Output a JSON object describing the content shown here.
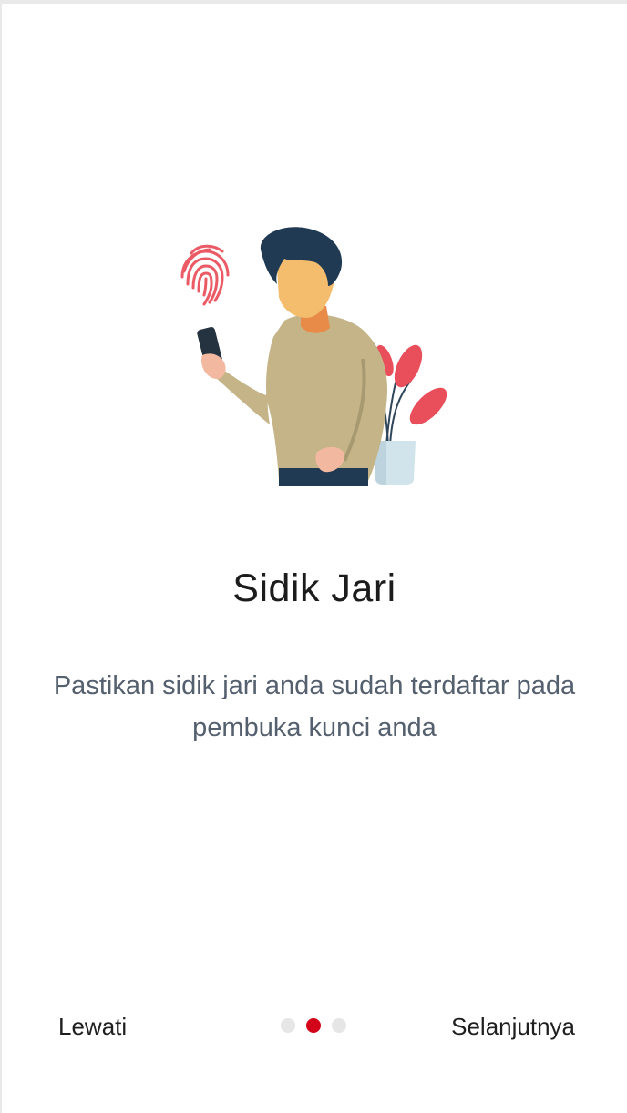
{
  "onboarding": {
    "title": "Sidik Jari",
    "description": "Pastikan sidik jari anda sudah terdaftar pada pembuka kunci anda",
    "illustration_icon": "person-fingerprint-illustration",
    "fingerprint_color": "#e94e5b"
  },
  "footer": {
    "skip_label": "Lewati",
    "next_label": "Selanjutnya",
    "pagination": {
      "total": 3,
      "active_index": 1,
      "active_color": "#d3041a",
      "inactive_color": "#e6e6e6"
    }
  }
}
